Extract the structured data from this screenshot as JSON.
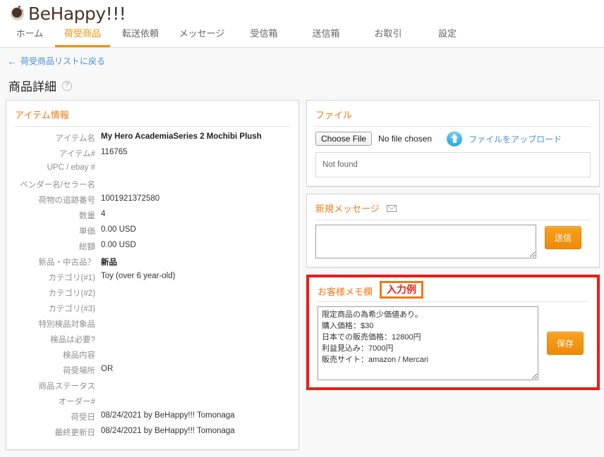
{
  "brand": {
    "name": "BeHappy!!!",
    "logo_icon": "coffee-bean-icon",
    "color": "#4a3528"
  },
  "nav": {
    "active_index": 1,
    "items": [
      {
        "label": "ホーム"
      },
      {
        "label": "荷受商品"
      },
      {
        "label": "転送依頼"
      },
      {
        "label": "メッセージ"
      },
      {
        "label": "受信箱"
      },
      {
        "label": "送信箱"
      },
      {
        "label": "お取引"
      },
      {
        "label": "設定"
      }
    ],
    "active_color": "#f29100"
  },
  "subheader": {
    "back_link": "荷受商品リストに戻る",
    "back_arrow_icon": "arrow-left-icon",
    "page_title": "商品詳細",
    "help_icon": "question-mark-icon"
  },
  "item_info": {
    "title": "アイテム情報",
    "rows": [
      {
        "label": "アイテム名",
        "value": "My Hero AcademiaSeries 2 Mochibi Plush",
        "strong": true
      },
      {
        "label": "アイテム#",
        "value": "116765"
      },
      {
        "label": "UPC / ebay #",
        "value": ""
      },
      {
        "label": "ベンダー名/セラー名",
        "value": ""
      },
      {
        "label": "荷物の追跡番号",
        "value": "1001921372580"
      },
      {
        "label": "数量",
        "value": "4"
      },
      {
        "label": "単価",
        "value": "0.00 USD"
      },
      {
        "label": "総額",
        "value": "0.00 USD"
      },
      {
        "label": "新品・中古品？",
        "value": "新品",
        "strong": true
      },
      {
        "label": "カテゴリ(#1)",
        "value": "Toy (over 6 year-old)"
      },
      {
        "label": "カテゴリ(#2)",
        "value": ""
      },
      {
        "label": "カテゴリ(#3)",
        "value": ""
      },
      {
        "label": "特別検品対象品",
        "value": ""
      },
      {
        "label": "検品は必要?",
        "value": ""
      },
      {
        "label": "検品内容",
        "value": ""
      },
      {
        "label": "荷受場所",
        "value": "OR"
      },
      {
        "label": "商品ステータス",
        "value": ""
      },
      {
        "label": "オーダー#",
        "value": ""
      },
      {
        "label": "荷受日",
        "value": "08/24/2021 by BeHappy!!! Tomonaga"
      },
      {
        "label": "最終更新日",
        "value": "08/24/2021 by BeHappy!!! Tomonaga"
      }
    ]
  },
  "file_card": {
    "title": "ファイル",
    "choose_file_label": "Choose File",
    "no_file_text": "No file chosen",
    "upload_icon": "upload-circle-icon",
    "upload_link": "ファイルをアップロード",
    "list_empty_text": "Not found"
  },
  "message_card": {
    "title": "新規メッセージ",
    "mail_icon": "envelope-icon",
    "textarea_value": "",
    "textarea_placeholder": "",
    "send_label": "送信"
  },
  "memo_card": {
    "title": "お客様メモ欄",
    "badge": "入力例",
    "badge_text_color": "#e8221c",
    "badge_border_color": "#f07818",
    "memo_value": "限定商品の為希少価値あり。\n購入価格：$30\n日本での販売価格：12800円\n利益見込み：7000円\n販売サイト：amazon / Mercari",
    "save_label": "保存",
    "highlight_color": "#ef1b18"
  }
}
